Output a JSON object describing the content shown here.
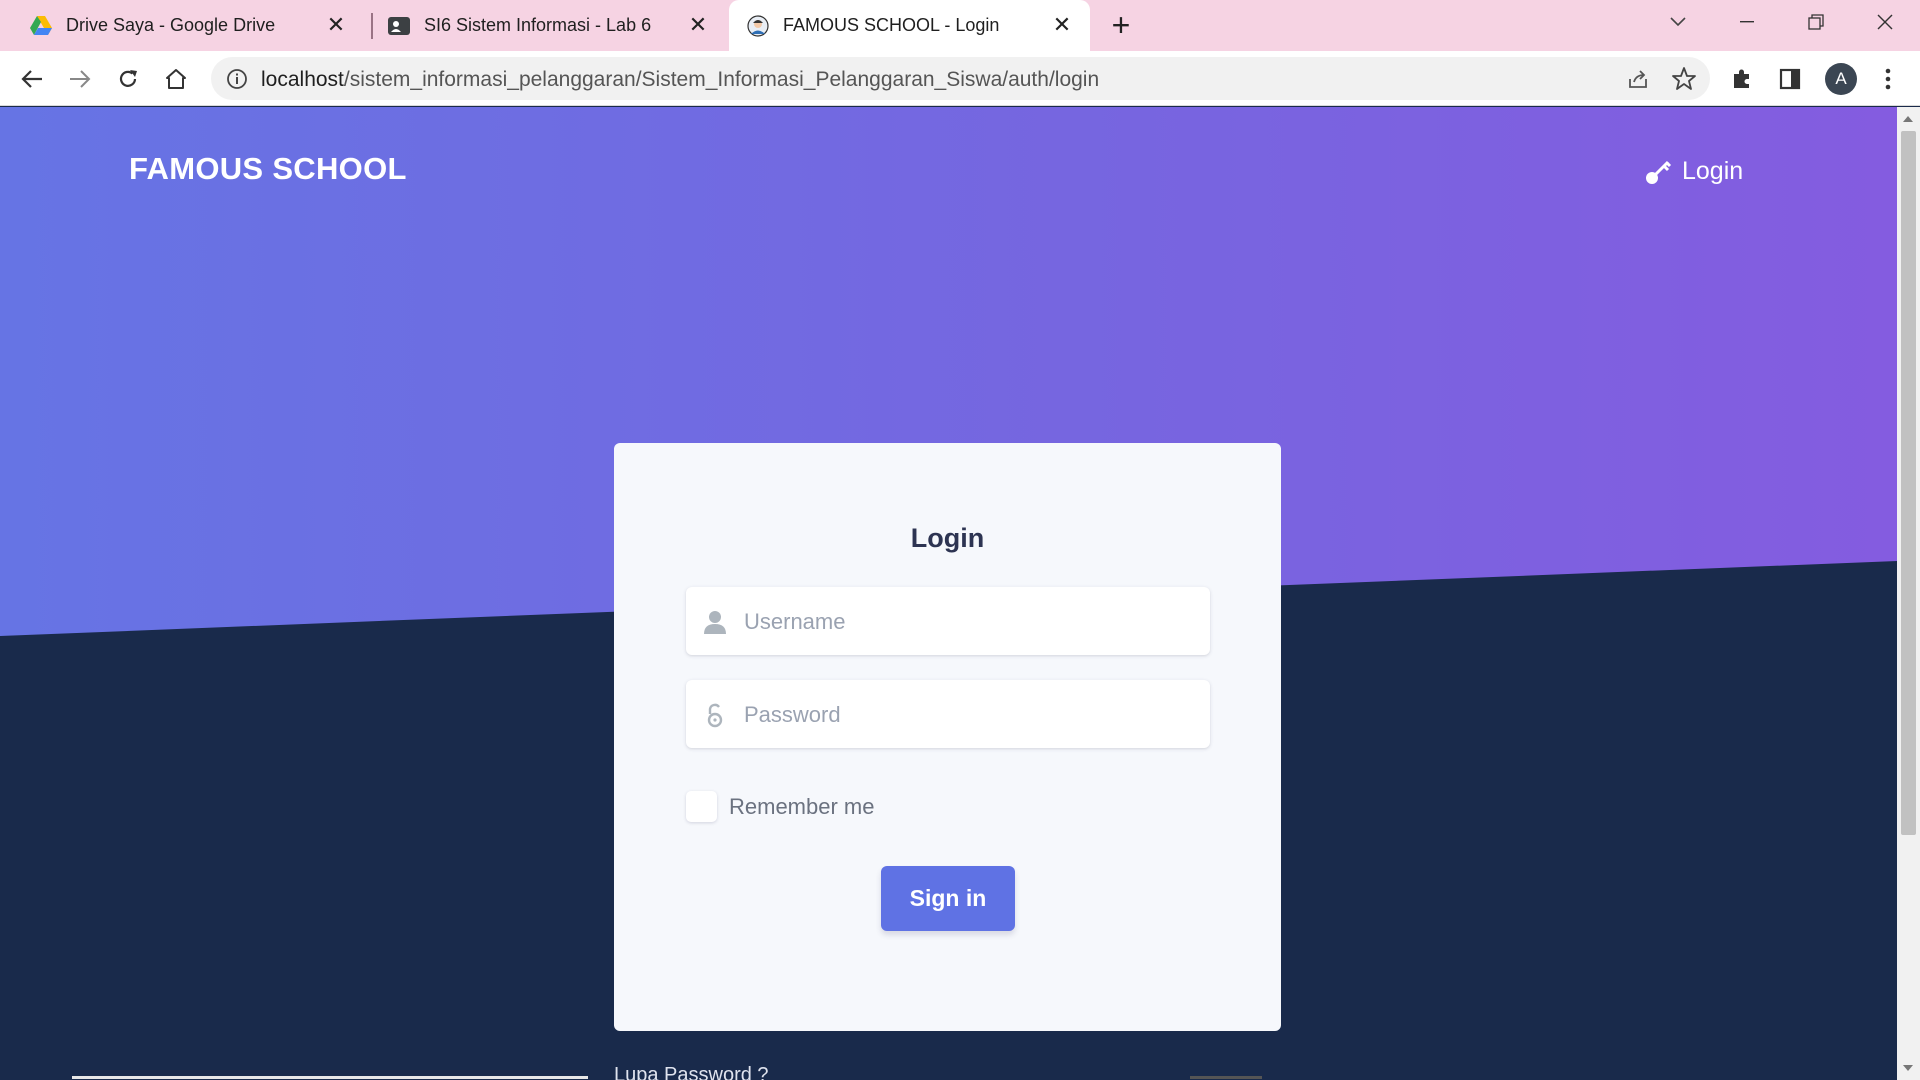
{
  "browser": {
    "tabs": [
      {
        "title": "Drive Saya - Google Drive",
        "icon": "google-drive-icon"
      },
      {
        "title": "SI6 Sistem Informasi - Lab 6",
        "icon": "contact-card-icon"
      },
      {
        "title": "FAMOUS SCHOOL - Login",
        "icon": "avatar-favicon-icon"
      }
    ],
    "active_tab": 2,
    "url_host": "localhost",
    "url_path": "/sistem_informasi_pelanggaran/Sistem_Informasi_Pelanggaran_Siswa/auth/login",
    "profile_initial": "A"
  },
  "navbar": {
    "brand": "FAMOUS SCHOOL",
    "login_label": "Login"
  },
  "card": {
    "title": "Login",
    "username_placeholder": "Username",
    "password_placeholder": "Password",
    "remember_label": "Remember me",
    "signin_label": "Sign in"
  },
  "footer": {
    "forgot_password": "Lupa Password ?"
  },
  "colors": {
    "hero_start": "#6674e4",
    "hero_end": "#845ce0",
    "page_dark": "#192a4b",
    "primary_button": "#5f72e4",
    "tab_strip": "#f6d3e3"
  }
}
